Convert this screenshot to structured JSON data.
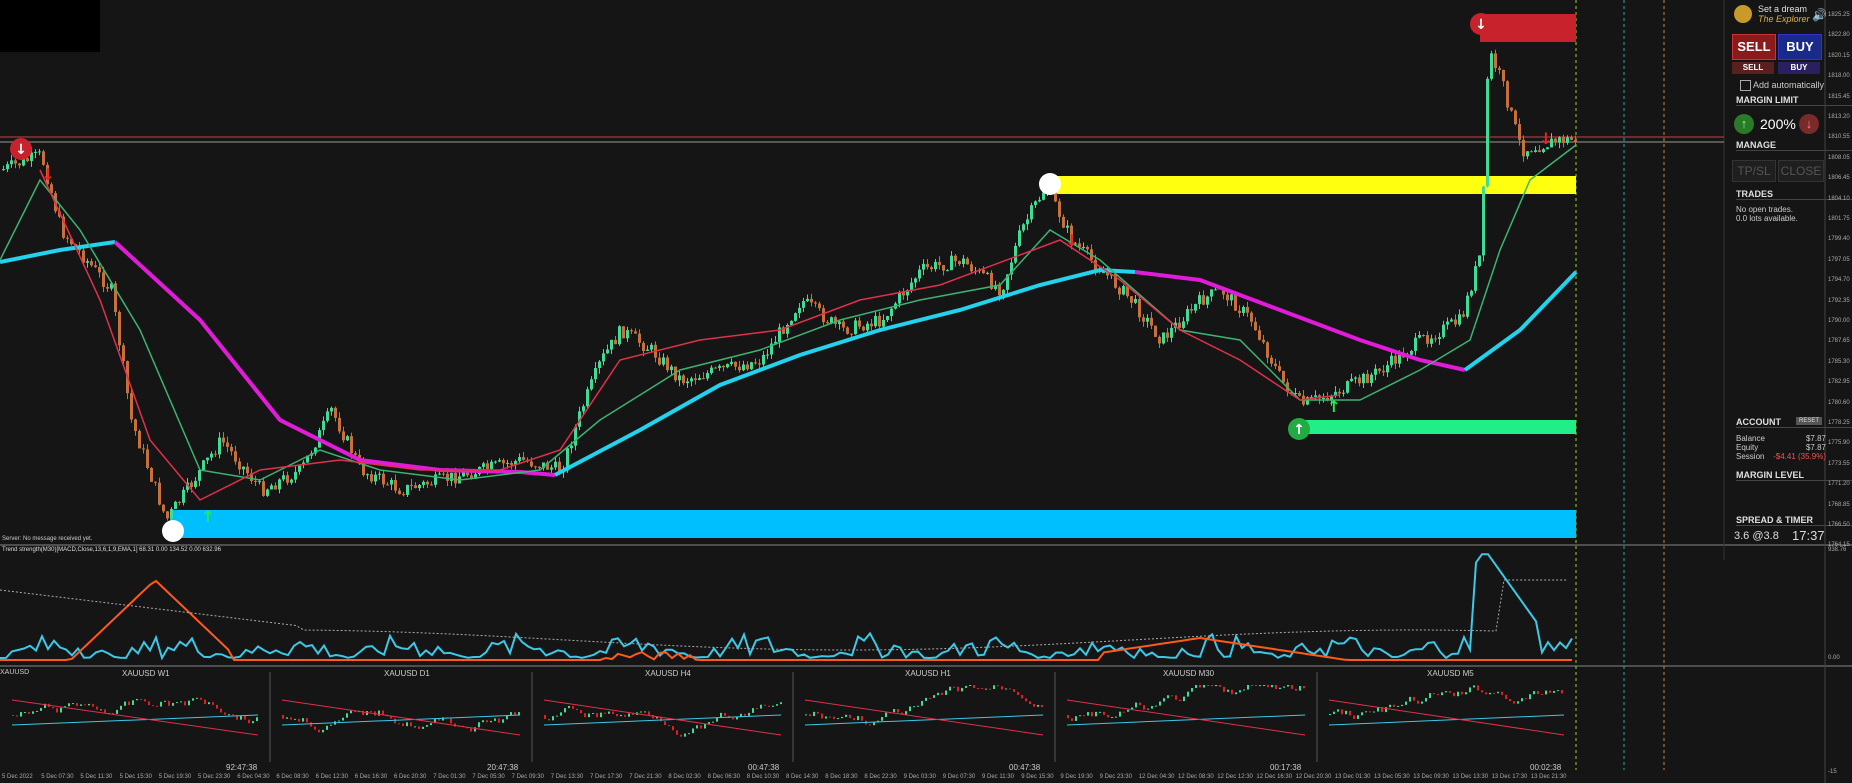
{
  "panel": {
    "logo_line1": "Set a dream",
    "logo_line2": "The Explorer",
    "sell_big": "SELL",
    "buy_big": "BUY",
    "sell_small": "SELL",
    "buy_small": "BUY",
    "add_auto": "Add automatically",
    "margin_limit": "MARGIN LIMIT",
    "margin_pct": "200%",
    "manage": "MANAGE",
    "tpsl": "TP/SL",
    "close": "CLOSE",
    "trades": "TRADES",
    "no_trades": "No open trades.",
    "lots": "0.0 lots available.",
    "account": "ACCOUNT",
    "reset": "RESET",
    "balance_label": "Balance",
    "balance_value": "$7.87",
    "equity_label": "Equity",
    "equity_value": "$7.87",
    "session_label": "Session",
    "session_value": "-$4.41 (35.9%)",
    "margin_level": "MARGIN LEVEL",
    "spread_timer": "SPREAD & TIMER",
    "spread_value": "3.6 @3.8",
    "timer_value": "17:37"
  },
  "status": {
    "server": "Server: No message received yet."
  },
  "indicator": {
    "title": "Trend strength(M30)[MACD,Close,13,6,1,9,EMA,1] 68.31 0.00 134.52 0.00 632.96"
  },
  "mini_charts": [
    {
      "label": "XAUUSD W1",
      "time": "92:47:38"
    },
    {
      "label": "XAUUSD D1",
      "time": "20:47:38"
    },
    {
      "label": "XAUUSD H4",
      "time": "00:47:38"
    },
    {
      "label": "XAUUSD H1",
      "time": "00:47:38"
    },
    {
      "label": "XAUUSD M30",
      "time": "00:17:38"
    },
    {
      "label": "XAUUSD M5",
      "time": "00:02:38"
    }
  ],
  "mini_symbol": "XAUUSD",
  "price_axis": [
    "1825.25",
    "1822.80",
    "1820.15",
    "1818.00",
    "1815.45",
    "1813.20",
    "1810.55",
    "1808.05",
    "1806.45",
    "1804.10",
    "1801.75",
    "1799.40",
    "1797.05",
    "1794.70",
    "1792.35",
    "1790.00",
    "1787.65",
    "1785.30",
    "1782.95",
    "1780.60",
    "1778.25",
    "1775.90",
    "1773.55",
    "1771.20",
    "1768.85",
    "1766.50",
    "1764.15"
  ],
  "time_axis": [
    "5 Dec 2022",
    "5 Dec 07:30",
    "5 Dec 11:30",
    "5 Dec 15:30",
    "5 Dec 19:30",
    "5 Dec 23:30",
    "6 Dec 04:30",
    "6 Dec 08:30",
    "6 Dec 12:30",
    "6 Dec 16:30",
    "6 Dec 20:30",
    "7 Dec 01:30",
    "7 Dec 05:30",
    "7 Dec 09:30",
    "7 Dec 13:30",
    "7 Dec 17:30",
    "7 Dec 21:30",
    "8 Dec 02:30",
    "8 Dec 06:30",
    "8 Dec 10:30",
    "8 Dec 14:30",
    "8 Dec 18:30",
    "8 Dec 22:30",
    "9 Dec 03:30",
    "9 Dec 07:30",
    "9 Dec 11:30",
    "9 Dec 15:30",
    "9 Dec 19:30",
    "9 Dec 23:30",
    "12 Dec 04:30",
    "12 Dec 08:30",
    "12 Dec 12:30",
    "12 Dec 16:30",
    "12 Dec 20:30",
    "13 Dec 01:30",
    "13 Dec 05:30",
    "13 Dec 09:30",
    "13 Dec 13:30",
    "13 Dec 17:30",
    "13 Dec 21:30"
  ],
  "indicator_axis": [
    "938.76",
    "0.00",
    "-15"
  ],
  "colors": {
    "bull": "#3ddc97",
    "bear": "#c8703a",
    "ma_slow_up": "#22d3ee",
    "ma_slow_down": "#e01cd8",
    "ma_fast": "#3cb371",
    "ma_red": "#e0304a",
    "zone_yellow": "#ffff10",
    "zone_cyan": "#00bfff",
    "zone_green": "#22ee88",
    "zone_red": "#c8232c"
  }
}
